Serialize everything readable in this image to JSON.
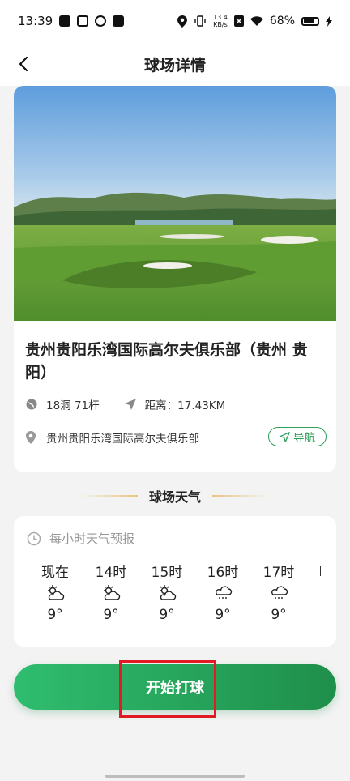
{
  "status_bar": {
    "time": "13:39",
    "net_speed_value": "13.4",
    "net_speed_unit": "KB/s",
    "battery": "68%"
  },
  "header": {
    "title": "球场详情"
  },
  "course": {
    "name": "贵州贵阳乐湾国际高尔夫俱乐部（贵州 贵阳）",
    "holes": "18洞 71杆",
    "distance": "距离：17.43KM",
    "address": "贵州贵阳乐湾国际高尔夫俱乐部",
    "nav_label": "导航"
  },
  "weather": {
    "section_title": "球场天气",
    "hourly_label": "每小时天气预报",
    "hours": [
      {
        "label": "现在",
        "icon": "partly-cloudy-icon",
        "temp": "9°"
      },
      {
        "label": "14时",
        "icon": "partly-cloudy-icon",
        "temp": "9°"
      },
      {
        "label": "15时",
        "icon": "partly-cloudy-icon",
        "temp": "9°"
      },
      {
        "label": "16时",
        "icon": "light-rain-icon",
        "temp": "9°"
      },
      {
        "label": "17时",
        "icon": "light-rain-icon",
        "temp": "9°"
      }
    ]
  },
  "actions": {
    "start_label": "开始打球"
  },
  "colors": {
    "accent_green": "#2e9e58",
    "highlight_red": "#e01b24"
  }
}
